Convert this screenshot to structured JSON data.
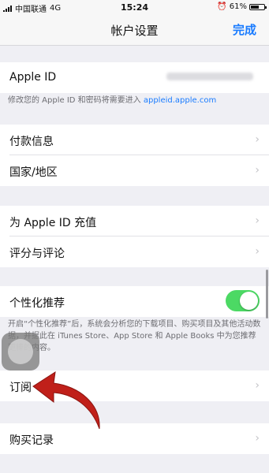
{
  "status_bar": {
    "carrier": "中国联通",
    "network": "4G",
    "time": "15:24",
    "battery_text": "61%",
    "battery_level": 0.61
  },
  "nav": {
    "title": "帐户设置",
    "done_label": "完成"
  },
  "apple_id": {
    "label": "Apple ID",
    "footnote_prefix": "修改您的 Apple ID 和密码将需要进入 ",
    "footnote_link": "appleid.apple.com"
  },
  "payment_group": {
    "items": [
      {
        "label": "付款信息"
      },
      {
        "label": "国家/地区"
      }
    ]
  },
  "topup_group": {
    "items": [
      {
        "label": "为 Apple ID 充值"
      },
      {
        "label": "评分与评论"
      }
    ]
  },
  "personalization": {
    "label": "个性化推荐",
    "enabled": true,
    "toggle_color": "#4cd964",
    "footnote": "开启“个性化推荐”后，系统会分析您的下载项目、购买项目及其他活动数据，并据此在 iTunes Store、App Store 和 Apple Books 中为您推荐更棒的内容。"
  },
  "subscriptions": {
    "label": "订阅"
  },
  "purchase_history": {
    "label": "购买记录"
  },
  "colors": {
    "accent": "#1a7cff",
    "background": "#efeff4",
    "arrow": "#c0201a"
  },
  "icons": {
    "chevron": "chevron-right-icon",
    "assistive_touch": "assistive-touch-icon",
    "annotation_arrow": "curved-arrow-icon"
  }
}
